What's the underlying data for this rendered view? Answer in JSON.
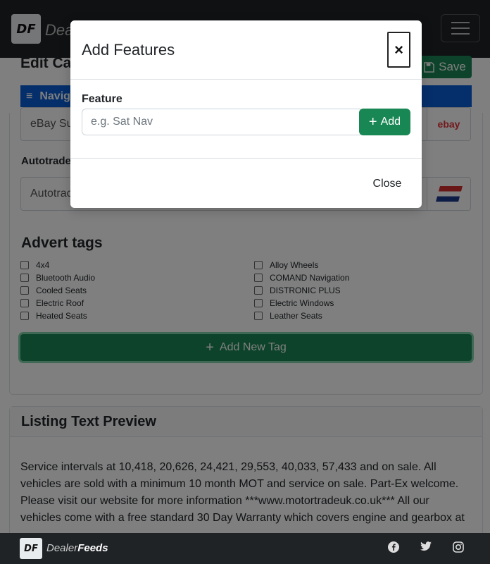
{
  "brand": {
    "logo_mark": "DF",
    "name_light": "Dealer",
    "name_bold": "Feeds",
    "header_text_partial": "Deal"
  },
  "page": {
    "title_partial": "Edit Ca",
    "save_label": "Save",
    "nav_label_partial": "Navig",
    "ebay_input_partial": "eBay Su",
    "ebay_badge": "ebay",
    "autotrader_label_partial": "Autotrade",
    "autotrader_input_partial": "Autotrac"
  },
  "tags": {
    "heading": "Advert tags",
    "left": [
      "4x4",
      "Bluetooth Audio",
      "Cooled Seats",
      "Electric Roof",
      "Heated Seats"
    ],
    "right": [
      "Alloy Wheels",
      "COMAND Navigation",
      "DISTRONIC PLUS",
      "Electric Windows",
      "Leather Seats"
    ],
    "add_label": "Add New Tag"
  },
  "preview": {
    "heading": "Listing Text Preview",
    "text": "Service intervals at 10,418, 20,626, 24,421, 29,553, 40,033, 57,433 and on sale. All vehicles are sold with a minimum 10 month MOT and service on sale. Part-Ex welcome. Please visit our website for more information ***www.motortradeuk.co.uk*** All our vehicles come with a free standard 30 Day Warranty which covers engine and gearbox at"
  },
  "modal": {
    "title": "Add Features",
    "close_symbol": "×",
    "feature_label": "Feature",
    "feature_placeholder": "e.g. Sat Nav",
    "feature_value": "",
    "add_label": "Add",
    "close_label": "Close"
  },
  "footer": {
    "social": [
      "facebook-icon",
      "twitter-icon",
      "instagram-icon"
    ]
  },
  "colors": {
    "primary_green": "#198754",
    "nav_blue": "#0b5ed7",
    "dark_bar": "#1f2326"
  }
}
